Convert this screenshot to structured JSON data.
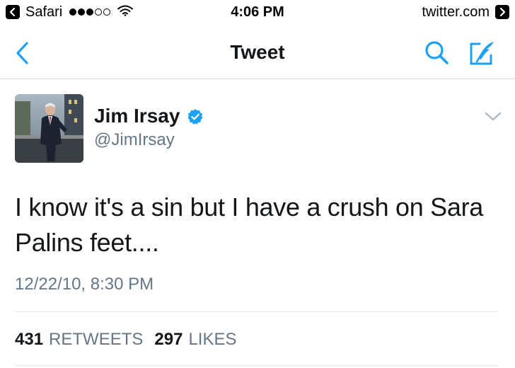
{
  "status_bar": {
    "carrier": "Safari",
    "time": "4:06 PM",
    "site": "twitter.com"
  },
  "nav": {
    "title": "Tweet"
  },
  "tweet": {
    "display_name": "Jim Irsay",
    "handle": "@JimIrsay",
    "text": "I know it's a sin but I have a crush on Sara Palins feet....",
    "timestamp": "12/22/10, 8:30 PM",
    "retweets_count": "431",
    "retweets_label": "RETWEETS",
    "likes_count": "297",
    "likes_label": "LIKES"
  },
  "colors": {
    "accent": "#1da1f2",
    "text_primary": "#14171a",
    "text_secondary": "#657786",
    "divider": "#e1e8ed"
  },
  "icons": {
    "back": "chevron-left-icon",
    "search": "search-icon",
    "compose": "compose-icon",
    "verified": "verified-badge-icon",
    "caret": "chevron-down-icon"
  }
}
